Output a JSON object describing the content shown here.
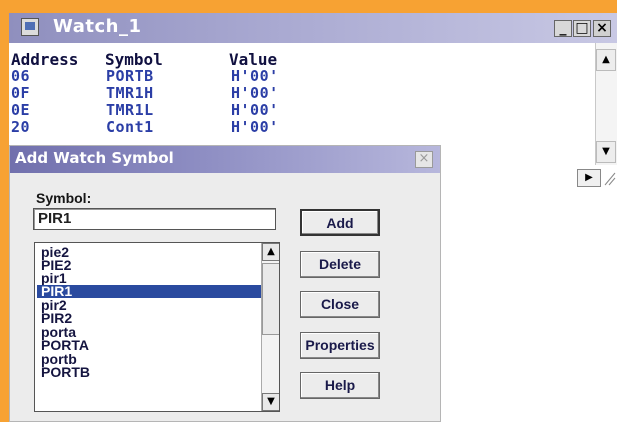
{
  "watch_window": {
    "title": "Watch_1",
    "controls": {
      "minimize": "_",
      "maximize": "□",
      "close": "×"
    },
    "columns": [
      "Address",
      "Symbol",
      "Value"
    ],
    "rows": [
      {
        "address": "06",
        "symbol": "PORTB",
        "value": "H'00'"
      },
      {
        "address": "0F",
        "symbol": "TMR1H",
        "value": "H'00'"
      },
      {
        "address": "0E",
        "symbol": "TMR1L",
        "value": "H'00'"
      },
      {
        "address": "20",
        "symbol": "Cont1",
        "value": "H'00'"
      }
    ]
  },
  "dialog": {
    "title": "Add Watch Symbol",
    "close_label": "×",
    "symbol_label": "Symbol:",
    "symbol_value": "PIR1",
    "list_items": [
      "pie2",
      "PIE2",
      "pir1",
      "PIR1",
      "pir2",
      "PIR2",
      "porta",
      "PORTA",
      "portb",
      "PORTB"
    ],
    "selected_item": "PIR1",
    "buttons": {
      "add": "Add",
      "delete": "Delete",
      "close": "Close",
      "properties": "Properties",
      "help": "Help"
    }
  },
  "colors": {
    "frame_background": "#f7a233",
    "title_bar": "#8f8fbe",
    "selection": "#2a4a9f",
    "value_text": "#2b3ea6"
  },
  "icons": [
    "app-icon",
    "minimize-icon",
    "maximize-icon",
    "close-icon",
    "scroll-up-icon",
    "scroll-down-icon",
    "scroll-right-icon",
    "resize-grip-icon"
  ]
}
